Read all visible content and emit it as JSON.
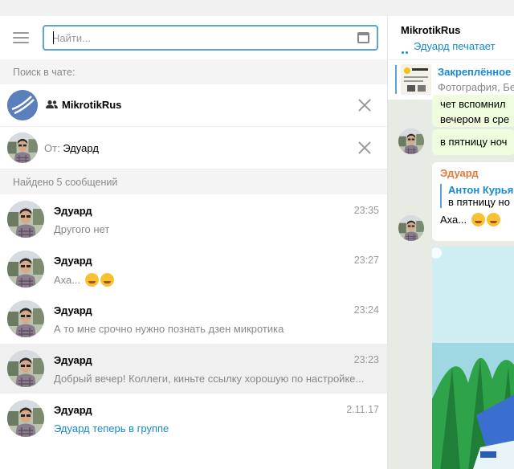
{
  "search": {
    "placeholder": "Найти..."
  },
  "filters": {
    "header": "Поиск в чате:",
    "chat_name": "MikrotikRus",
    "from_prefix": "От:",
    "from_name": "Эдуард"
  },
  "results": {
    "header": "Найдено 5 сообщений",
    "items": [
      {
        "name": "Эдуард",
        "time": "23:35",
        "text": "Другого нет"
      },
      {
        "name": "Эдуард",
        "time": "23:27",
        "text": "Аха..."
      },
      {
        "name": "Эдуард",
        "time": "23:24",
        "text": "А то мне срочно нужно познать дзен микротика"
      },
      {
        "name": "Эдуард",
        "time": "23:23",
        "text": "Добрый вечер! Коллеги, киньте ссылку хорошую по настройке..."
      },
      {
        "name": "Эдуард",
        "time": "2.11.17",
        "text": "Эдуард теперь в группе"
      }
    ]
  },
  "chat": {
    "title": "MikrotikRus",
    "status": "Эдуард печатает",
    "pinned_title": "Закреплённое",
    "pinned_text": "Фотография, Бе",
    "messages": {
      "m1_line1": "чет вспомнил",
      "m1_line2": "вечером в сре",
      "m2": "в пятницу ноч",
      "m3_author": "Эдуард",
      "m3_reply_name": "Антон Курья",
      "m3_reply_text": "в пятницу но",
      "m3_text": "Аха..."
    }
  },
  "colors": {
    "accent": "#168acd",
    "search_border": "#5ea3d4",
    "author": "#e07b39",
    "chat_bg": "#e7ebe4",
    "own_bubble": "#effdde"
  },
  "icons": {
    "menu": "hamburger-icon",
    "calendar": "calendar-icon",
    "group": "group-icon",
    "close": "close-icon",
    "typing": "typing-dots-icon",
    "emoji": "grinning-squinting-face-emoji"
  }
}
